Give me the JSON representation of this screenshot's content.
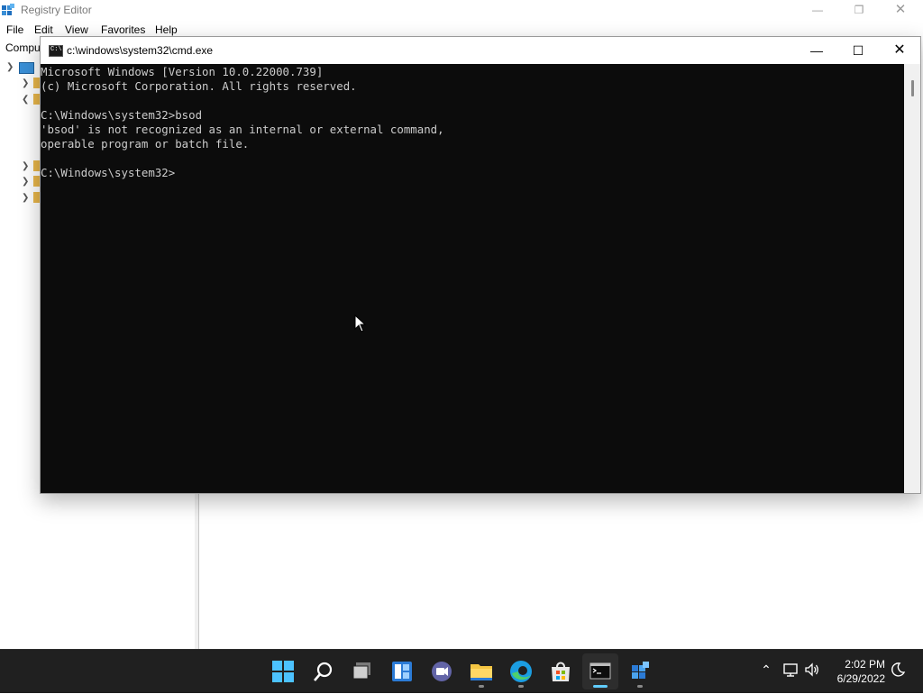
{
  "regedit": {
    "title": "Registry Editor",
    "menu": [
      "File",
      "Edit",
      "View",
      "Favorites",
      "Help"
    ],
    "address_fragment": "Compu"
  },
  "cmd": {
    "title": "c:\\windows\\system32\\cmd.exe",
    "icon_text": "C:\\",
    "lines": [
      "Microsoft Windows [Version 10.0.22000.739]",
      "(c) Microsoft Corporation. All rights reserved.",
      "",
      "C:\\Windows\\system32>bsod",
      "'bsod' is not recognized as an internal or external command,",
      "operable program or batch file.",
      "",
      "C:\\Windows\\system32>"
    ]
  },
  "taskbar": {
    "apps": [
      "start",
      "search",
      "task-view",
      "widgets",
      "chat",
      "file-explorer",
      "edge",
      "store",
      "command-prompt",
      "registry-editor"
    ],
    "clock": {
      "time": "2:02 PM",
      "date": "6/29/2022"
    }
  },
  "colors": {
    "console_bg": "#0c0c0c",
    "console_text": "#cccccc",
    "taskbar_bg": "#202020",
    "accent": "#60cdff"
  }
}
